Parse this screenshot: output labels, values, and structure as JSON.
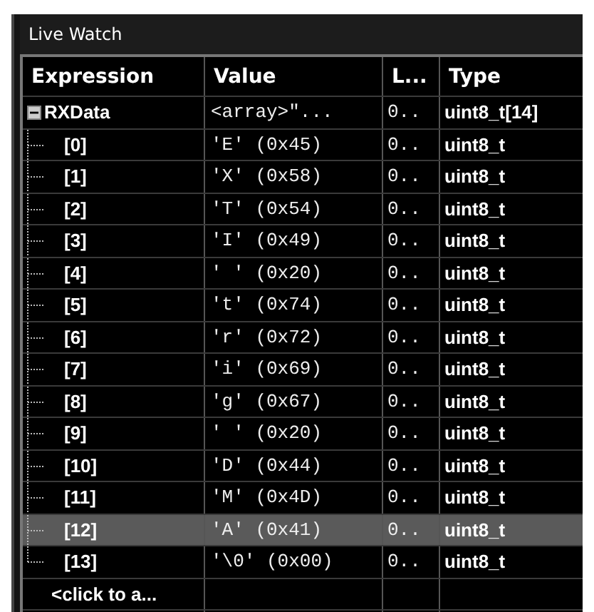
{
  "window": {
    "title": "Live Watch"
  },
  "columns": [
    "Expression",
    "Value",
    "L...",
    "Type"
  ],
  "items": [
    {
      "expression": "RXData",
      "value": "<array>\"...",
      "location": "0..",
      "type": "uint8_t[14]",
      "expanded": true,
      "selected": false,
      "children": [
        {
          "expression": "[0]",
          "value": "'E' (0x45)",
          "location": "0..",
          "type": "uint8_t",
          "selected": false
        },
        {
          "expression": "[1]",
          "value": "'X' (0x58)",
          "location": "0..",
          "type": "uint8_t",
          "selected": false
        },
        {
          "expression": "[2]",
          "value": "'T' (0x54)",
          "location": "0..",
          "type": "uint8_t",
          "selected": false
        },
        {
          "expression": "[3]",
          "value": "'I' (0x49)",
          "location": "0..",
          "type": "uint8_t",
          "selected": false
        },
        {
          "expression": "[4]",
          "value": "' ' (0x20)",
          "location": "0..",
          "type": "uint8_t",
          "selected": false
        },
        {
          "expression": "[5]",
          "value": "'t' (0x74)",
          "location": "0..",
          "type": "uint8_t",
          "selected": false
        },
        {
          "expression": "[6]",
          "value": "'r' (0x72)",
          "location": "0..",
          "type": "uint8_t",
          "selected": false
        },
        {
          "expression": "[7]",
          "value": "'i' (0x69)",
          "location": "0..",
          "type": "uint8_t",
          "selected": false
        },
        {
          "expression": "[8]",
          "value": "'g' (0x67)",
          "location": "0..",
          "type": "uint8_t",
          "selected": false
        },
        {
          "expression": "[9]",
          "value": "' ' (0x20)",
          "location": "0..",
          "type": "uint8_t",
          "selected": false
        },
        {
          "expression": "[10]",
          "value": "'D' (0x44)",
          "location": "0..",
          "type": "uint8_t",
          "selected": false
        },
        {
          "expression": "[11]",
          "value": "'M' (0x4D)",
          "location": "0..",
          "type": "uint8_t",
          "selected": false
        },
        {
          "expression": "[12]",
          "value": "'A' (0x41)",
          "location": "0..",
          "type": "uint8_t",
          "selected": true
        },
        {
          "expression": "[13]",
          "value": "'\\0' (0x00)",
          "location": "0..",
          "type": "uint8_t",
          "selected": false
        }
      ]
    }
  ],
  "add_row": "<click to a..."
}
